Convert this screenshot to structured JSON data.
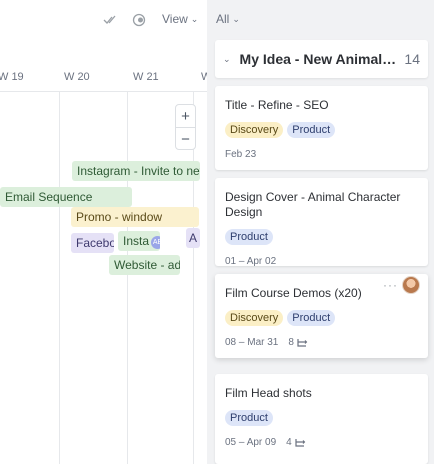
{
  "toolbar": {
    "view_label": "View",
    "filter_label": "All"
  },
  "timeline": {
    "weeks": [
      "W 19",
      "W 20",
      "W 21",
      "W"
    ],
    "zoom_in": "+",
    "zoom_out": "−",
    "bars": [
      {
        "label": "Instagram - Invite to new C",
        "color": "green"
      },
      {
        "label": "Email Sequence",
        "color": "green"
      },
      {
        "label": "Promo - window",
        "color": "yellow"
      },
      {
        "label": "Facebo",
        "color": "purple"
      },
      {
        "label": "Insta",
        "color": "green",
        "badge": "AB"
      },
      {
        "label": "A",
        "color": "purple"
      },
      {
        "label": "Website - add",
        "color": "green"
      }
    ]
  },
  "column": {
    "title": "My Idea - New Animal Charac...",
    "count": "14",
    "cards": [
      {
        "title": "Title - Refine - SEO",
        "tags": [
          "Discovery",
          "Product"
        ],
        "date": "Feb 23",
        "subtasks": ""
      },
      {
        "title": "Design Cover - Animal Character Design",
        "tags": [
          "Product"
        ],
        "date": "01 – Apr 02",
        "subtasks": ""
      },
      {
        "title": "Film Course Demos (x20)",
        "tags": [
          "Discovery",
          "Product"
        ],
        "date": "08 – Mar 31",
        "subtasks": "8",
        "more": "···"
      },
      {
        "title": "Film Head shots",
        "tags": [
          "Product"
        ],
        "date": "05 – Apr 09",
        "subtasks": "4"
      }
    ]
  },
  "colors": {
    "green_bar": "#dcefdc",
    "yellow_bar": "#fbf1cf",
    "purple_bar": "#e5e1f6",
    "discovery_tag": "#fbefc6",
    "product_tag": "#dde5f8",
    "column_bg": "#f1f2f4"
  }
}
